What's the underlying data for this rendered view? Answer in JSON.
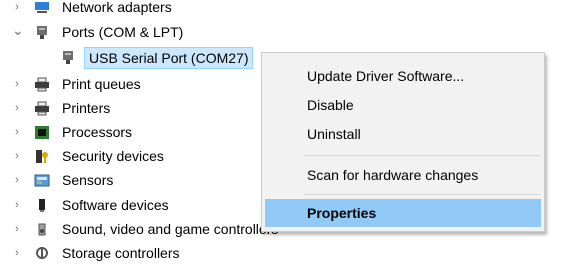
{
  "tree": {
    "network_adapters": "Network adapters",
    "ports": "Ports (COM & LPT)",
    "usb_serial": "USB Serial Port (COM27)",
    "print_queues": "Print queues",
    "printers": "Printers",
    "processors": "Processors",
    "security_devices": "Security devices",
    "sensors": "Sensors",
    "software_devices": "Software devices",
    "sound": "Sound, video and game controllers",
    "storage": "Storage controllers"
  },
  "context_menu": {
    "update_driver": "Update Driver Software...",
    "disable": "Disable",
    "uninstall": "Uninstall",
    "scan": "Scan for hardware changes",
    "properties": "Properties"
  },
  "glyphs": {
    "collapsed": "›",
    "expanded": "⌄"
  },
  "colors": {
    "menu_highlight": "#91c9f7",
    "selection": "#cce8ff"
  }
}
